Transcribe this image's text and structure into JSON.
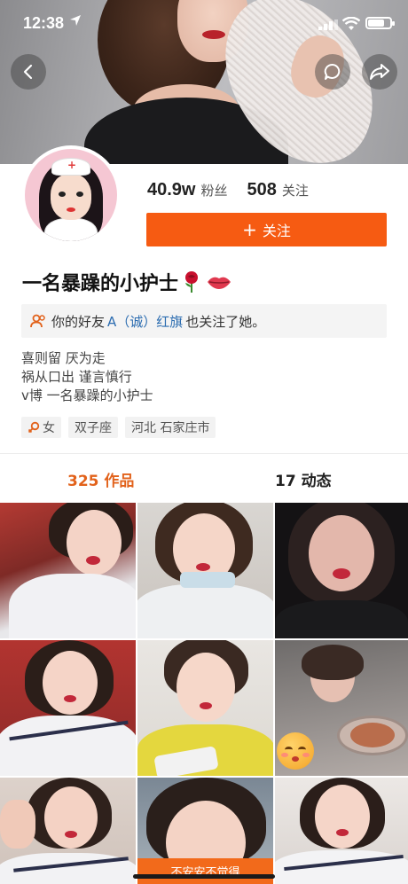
{
  "status_bar": {
    "time": "12:38"
  },
  "profile": {
    "fans_count": "40.9w",
    "fans_label": "粉丝",
    "following_count": "508",
    "following_label": "关注",
    "follow_button": "关注",
    "nickname": "一名暴躁的小护士",
    "friend_notice": {
      "prefix": "你的好友",
      "friend_name": "A（诚）红旗",
      "suffix": "也关注了她。"
    },
    "bio": [
      "喜则留 厌为走",
      "祸从口出 谨言慎行",
      "v博 一名暴躁的小护士"
    ],
    "tags": [
      "女",
      "双子座",
      "河北 石家庄市"
    ]
  },
  "tabs": {
    "works": "325 作品",
    "dynamics": "17 动态"
  },
  "grid_caption": "不安安不觉得",
  "colors": {
    "accent": "#f65b12",
    "active_tab": "#e2621b",
    "link": "#2b6cb0"
  },
  "icons": [
    "location-arrow-icon",
    "signal-icon",
    "wifi-icon",
    "battery-icon",
    "back-icon",
    "message-icon",
    "share-icon",
    "rose-icon",
    "lips-icon",
    "friends-icon",
    "female-icon"
  ]
}
